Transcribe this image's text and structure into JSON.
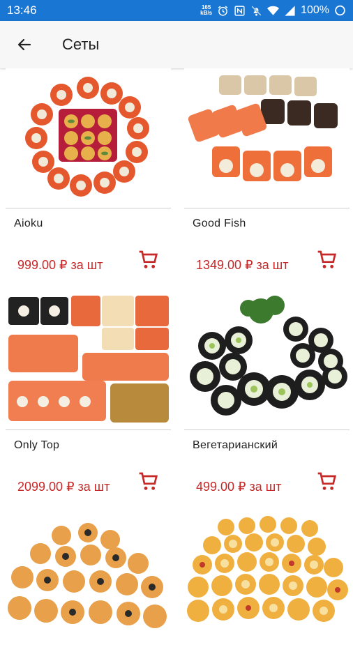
{
  "status_bar": {
    "time": "13:46",
    "speed_value": "165",
    "speed_unit": "kB/s",
    "battery_text": "100%"
  },
  "header": {
    "title": "Сеты",
    "back_icon": "arrow-back-icon"
  },
  "accent_color": "#c62828",
  "status_color": "#1976d2",
  "products": [
    {
      "name": "Aioku",
      "price": "999.00 ₽ за шт"
    },
    {
      "name": "Good Fish",
      "price": "1349.00 ₽ за шт"
    },
    {
      "name": "Only Top",
      "price": "2099.00 ₽ за шт"
    },
    {
      "name": "Вегетарианский",
      "price": "499.00 ₽ за шт"
    },
    {
      "name": "",
      "price": ""
    },
    {
      "name": "",
      "price": ""
    }
  ]
}
